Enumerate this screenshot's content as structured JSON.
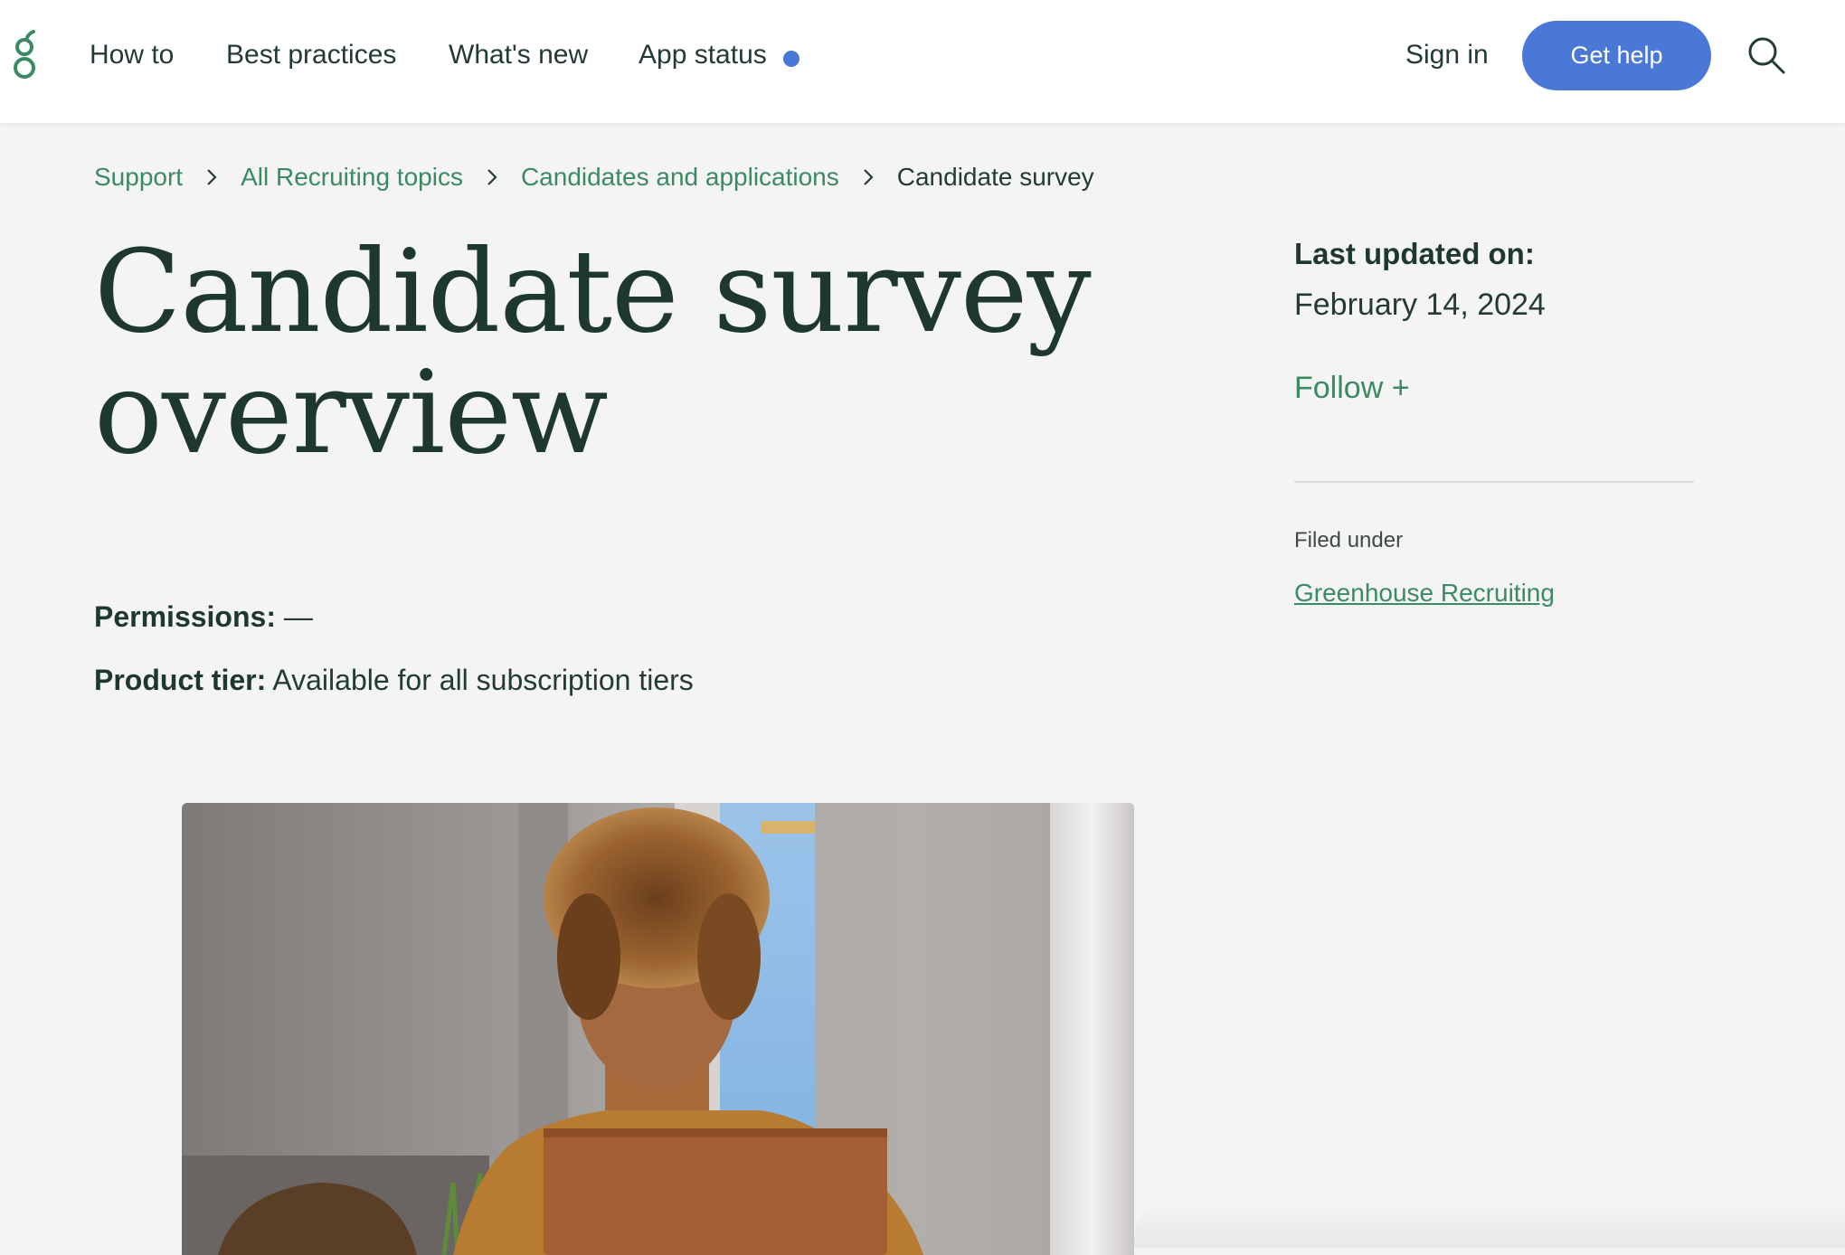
{
  "colors": {
    "brand_green": "#3a8a62",
    "link_green": "#3b8a63",
    "accent_blue": "#4a78d6",
    "text_dark": "#1e3830"
  },
  "header": {
    "logo_icon": "greenhouse-g-logo-icon",
    "nav": [
      "How to",
      "Best practices",
      "What's new",
      "App status"
    ],
    "app_status_indicator": "blue-status-dot",
    "sign_in": "Sign in",
    "get_help": "Get help",
    "search_icon": "search-icon"
  },
  "breadcrumb": {
    "items": [
      "Support",
      "All Recruiting topics",
      "Candidates and applications"
    ],
    "current": "Candidate survey",
    "separator_icon": "chevron-right-icon"
  },
  "article": {
    "title_line1": "Candidate survey",
    "title_line2": "overview",
    "permissions_label": "Permissions:",
    "permissions_value": " —",
    "product_tier_label": "Product tier:",
    "product_tier_value": " Available for all subscription tiers"
  },
  "sidebar": {
    "last_updated_label": "Last updated on:",
    "last_updated_date": "February 14, 2024",
    "follow": "Follow +",
    "filed_under_label": "Filed under",
    "filed_under_link": "Greenhouse Recruiting"
  }
}
